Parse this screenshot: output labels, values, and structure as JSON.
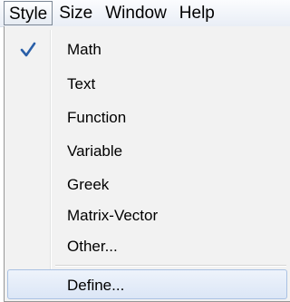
{
  "menubar": {
    "items": [
      "Style",
      "Size",
      "Window",
      "Help"
    ]
  },
  "style_menu": {
    "items": [
      {
        "label": "Math",
        "checked": true
      },
      {
        "label": "Text"
      },
      {
        "label": "Function"
      },
      {
        "label": "Variable"
      },
      {
        "label": "Greek"
      },
      {
        "label": "Matrix-Vector"
      },
      {
        "label": "Other..."
      },
      {
        "label": "Define...",
        "highlighted": true
      }
    ]
  },
  "icons": {
    "check": "checkmark-icon"
  },
  "colors": {
    "check": "#2a5fa8",
    "highlight_border": "#a9c1e3",
    "menu_background": "#f2f2f2"
  }
}
